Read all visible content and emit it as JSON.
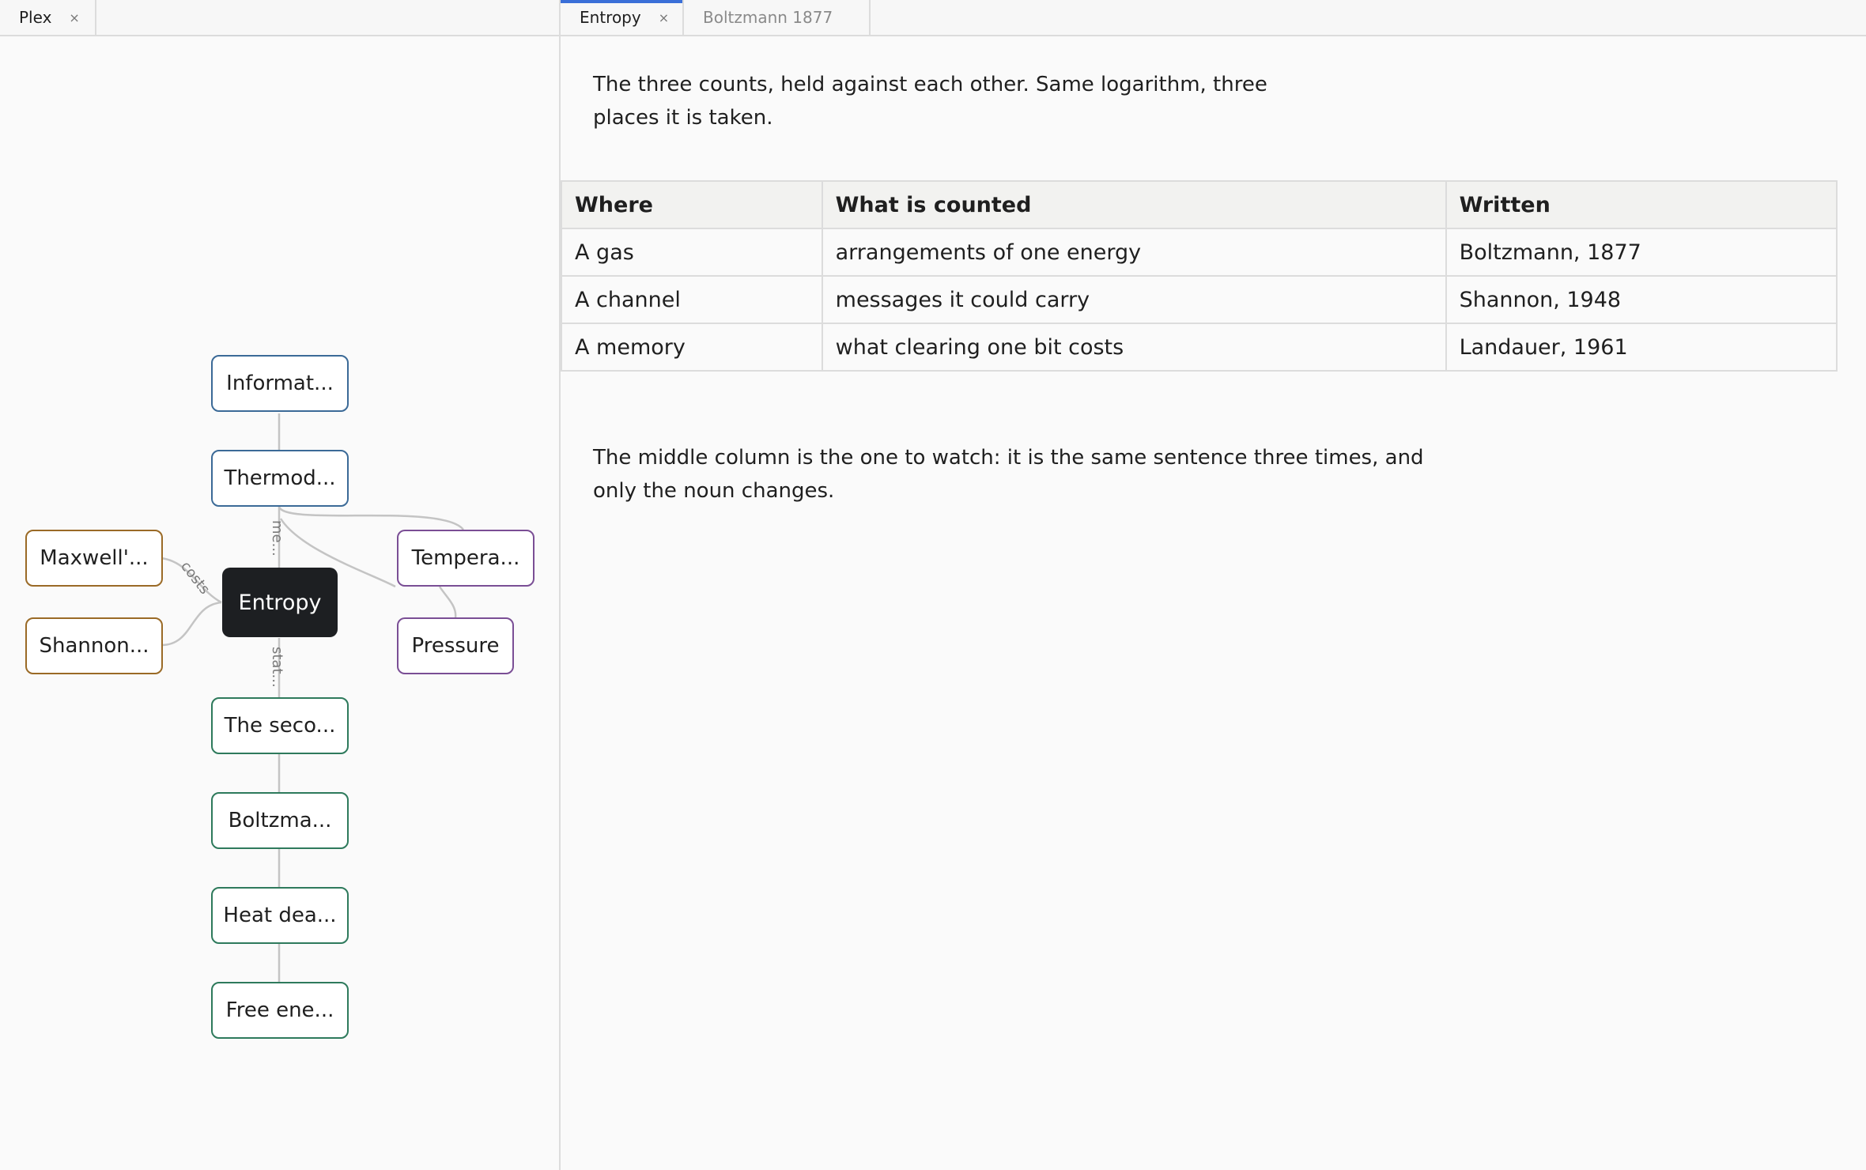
{
  "left_tabs": [
    {
      "label": "Plex",
      "close": "×"
    }
  ],
  "right_tabs": [
    {
      "label": "Entropy",
      "close": "×"
    },
    {
      "label": "Boltzmann 1877"
    }
  ],
  "graph": {
    "nodes": {
      "information": "Informat...",
      "thermodynamics": "Thermod...",
      "maxwell": "Maxwell'...",
      "shannon": "Shannon...",
      "entropy": "Entropy",
      "temperature": "Tempera...",
      "pressure": "Pressure",
      "second_law": "The seco...",
      "boltzmann": "Boltzma...",
      "heat_death": "Heat dea...",
      "free_energy": "Free ene..."
    },
    "edge_labels": {
      "thermo_entropy": "me...",
      "maxwell_entropy": "costs",
      "entropy_second": "stat..."
    }
  },
  "doc": {
    "intro": [
      "The three counts, held against each other. Same logarithm, three",
      "places it is taken."
    ],
    "table": {
      "headers": [
        "Where",
        "What is counted",
        "Written"
      ],
      "rows": [
        [
          "A gas",
          "arrangements of one energy",
          "Boltzmann, 1877"
        ],
        [
          "A channel",
          "messages it could carry",
          "Shannon, 1948"
        ],
        [
          "A memory",
          "what clearing one bit costs",
          "Landauer, 1961"
        ]
      ]
    },
    "outro": [
      "The middle column is the one to watch: it is the same sentence three times, and",
      "only the noun changes."
    ]
  }
}
